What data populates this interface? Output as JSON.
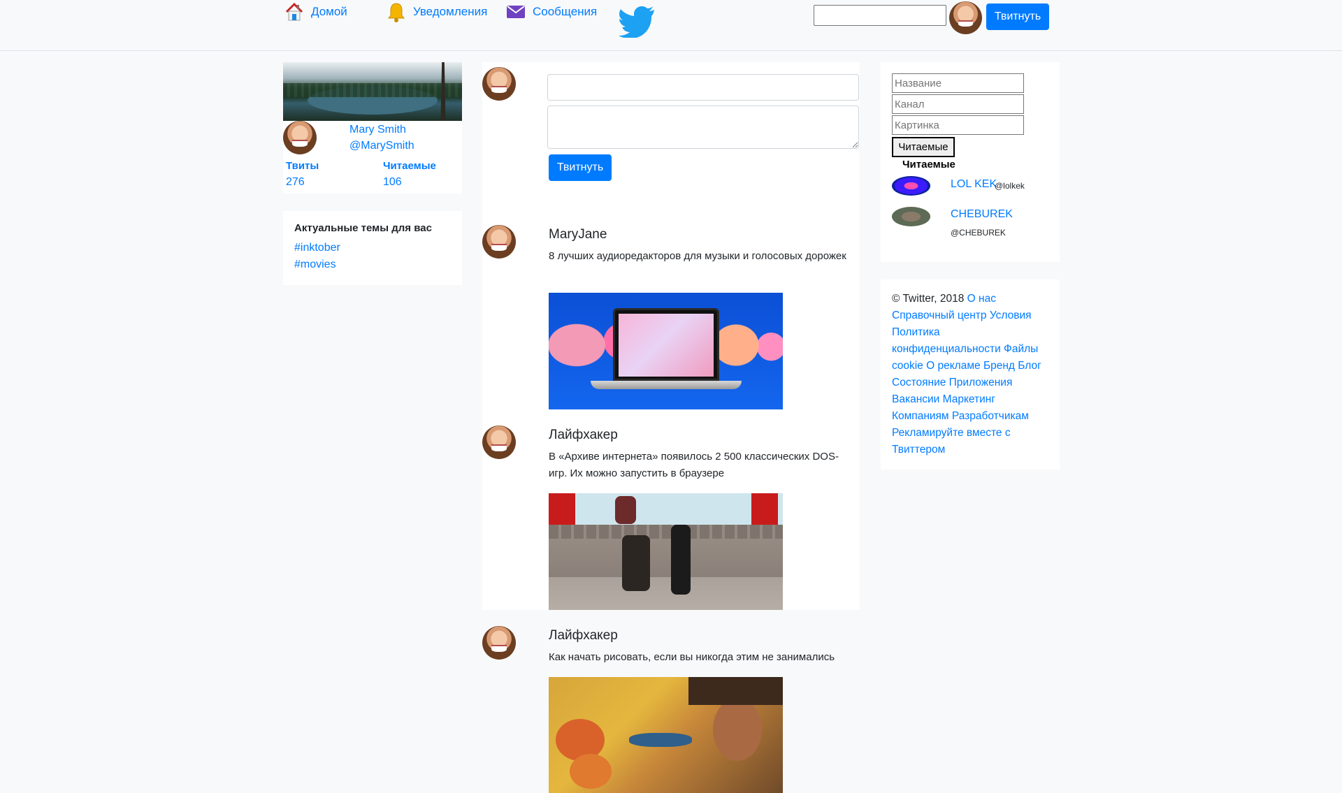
{
  "nav": {
    "home": "Домой",
    "notifications": "Уведомления",
    "messages": "Сообщения",
    "tweet_button": "Твитнуть",
    "search_value": ""
  },
  "profile": {
    "name": "Mary Smith",
    "handle": "@MarySmith",
    "tweets_label": "Твиты",
    "tweets_count": "276",
    "following_label": "Читаемые",
    "following_count": "106"
  },
  "trends": {
    "title": "Актуальные темы для вас",
    "items": [
      "#inktober",
      "#movies"
    ]
  },
  "compose": {
    "title_value": "",
    "body_value": "",
    "button": "Твитнуть"
  },
  "tweets": [
    {
      "author": "MaryJane",
      "text": "8 лучших аудиоредакторов для музыки и голосовых дорожек",
      "image": "audio-laptop"
    },
    {
      "author": "Лайфхакер",
      "text": "В «Архиве интернета» появилось 2 500 классических DOS-игр. Их можно запустить в браузере",
      "image": "dos-game-fight"
    },
    {
      "author": "Лайфхакер",
      "text": "Как начать рисовать, если вы никогда этим не занимались",
      "image": "painting-sunflowers"
    }
  ],
  "channel_form": {
    "name_placeholder": "Название",
    "channel_placeholder": "Канал",
    "image_placeholder": "Картинка",
    "button": "Читаемые",
    "list_title": "Читаемые"
  },
  "channels": [
    {
      "name": "LOL KEK",
      "handle": "@lolkek"
    },
    {
      "name": "CHEBUREK",
      "handle": "@CHEBUREK"
    }
  ],
  "footer": {
    "copyright": "© Twitter, 2018",
    "links": [
      "О нас",
      "Справочный центр",
      "Условия",
      "Политика конфиденциальности",
      "Файлы cookie",
      "О рекламе",
      "Бренд",
      "Блог",
      "Состояние",
      "Приложения",
      "Вакансии",
      "Маркетинг",
      "Компаниям",
      "Разработчикам",
      "Рекламируйте вместе с Твиттером"
    ]
  },
  "colors": {
    "accent": "#007bff",
    "background": "#f8f9fa",
    "card": "#ffffff",
    "twitter_blue": "#1da1f2"
  },
  "icons": {
    "home": "home-icon",
    "notifications": "bell-icon",
    "messages": "envelope-icon",
    "brand": "twitter-bird-icon"
  }
}
